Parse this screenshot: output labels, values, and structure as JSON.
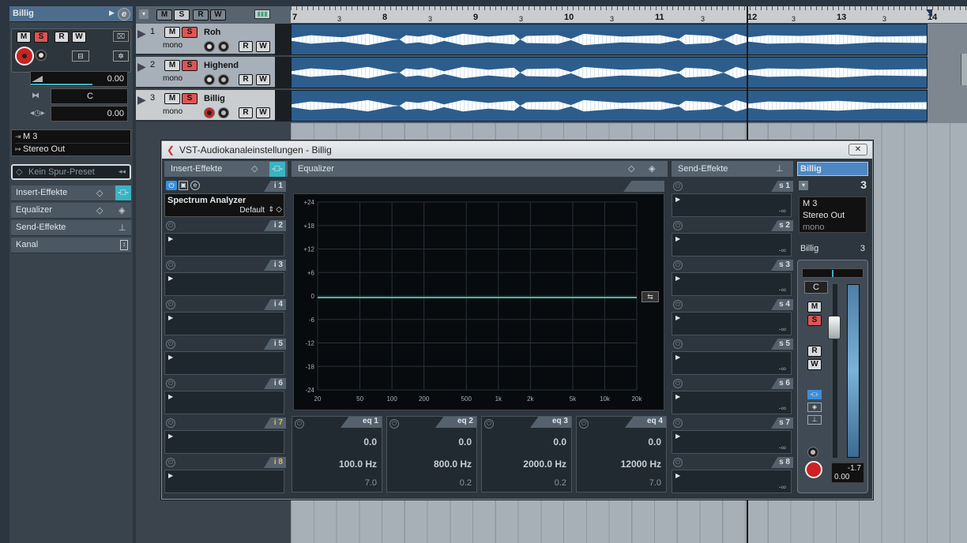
{
  "inspector": {
    "track_name": "Billig",
    "e_label": "e",
    "volume": "0.00",
    "pan": "C",
    "delay": "0.00",
    "input_routing": "M 3",
    "output_routing": "Stereo Out",
    "preset_placeholder": "Kein Spur-Preset",
    "sections": [
      "Insert-Effekte",
      "Equalizer",
      "Send-Effekte",
      "Kanal"
    ],
    "btn_m": "M",
    "btn_s": "S",
    "btn_r": "R",
    "btn_w": "W"
  },
  "tracklist": {
    "header_buttons": [
      "M",
      "S",
      "R",
      "W"
    ],
    "tracks": [
      {
        "num": "1",
        "name": "Roh",
        "mode": "mono"
      },
      {
        "num": "2",
        "name": "Highend",
        "mode": "mono"
      },
      {
        "num": "3",
        "name": "Billig",
        "mode": "mono"
      }
    ]
  },
  "ruler": {
    "bars": [
      "7",
      "8",
      "9",
      "10",
      "11",
      "12",
      "13",
      "14"
    ],
    "beats": [
      "3",
      "3",
      "3",
      "3",
      "3",
      "3",
      "3"
    ]
  },
  "dialog": {
    "title": "VST-Audiokanaleinstellungen - Billig",
    "close_label": "✕",
    "insert_panel_title": "Insert-Effekte",
    "eq_panel_title": "Equalizer",
    "send_panel_title": "Send-Effekte",
    "inserts": [
      {
        "slot": "i 1",
        "plugin": "Spectrum Analyzer",
        "preset": "Default"
      },
      {
        "slot": "i 2"
      },
      {
        "slot": "i 3"
      },
      {
        "slot": "i 4"
      },
      {
        "slot": "i 5"
      },
      {
        "slot": "i 6"
      },
      {
        "slot": "i 7"
      },
      {
        "slot": "i 8"
      }
    ],
    "sends": [
      {
        "slot": "s 1",
        "level": "-∞"
      },
      {
        "slot": "s 2",
        "level": "-∞"
      },
      {
        "slot": "s 3",
        "level": "-∞"
      },
      {
        "slot": "s 4",
        "level": "-∞"
      },
      {
        "slot": "s 5",
        "level": "-∞"
      },
      {
        "slot": "s 6",
        "level": "-∞"
      },
      {
        "slot": "s 7",
        "level": "-∞"
      },
      {
        "slot": "s 8",
        "level": "-∞"
      }
    ],
    "eq_graph": {
      "y_labels": [
        "+24",
        "+18",
        "+12",
        "+6",
        "0",
        "-6",
        "-12",
        "-18",
        "-24"
      ],
      "x_labels": [
        "20",
        "50",
        "100",
        "200",
        "500",
        "1k",
        "2k",
        "5k",
        "10k",
        "20k"
      ]
    },
    "eq_bands": [
      {
        "label": "eq 1",
        "gain": "0.0",
        "freq": "100.0 Hz",
        "q": "7.0"
      },
      {
        "label": "eq 2",
        "gain": "0.0",
        "freq": "800.0 Hz",
        "q": "0.2"
      },
      {
        "label": "eq 3",
        "gain": "0.0",
        "freq": "2000.0 Hz",
        "q": "0.2"
      },
      {
        "label": "eq 4",
        "gain": "0.0",
        "freq": "12000 Hz",
        "q": "7.0"
      }
    ],
    "channel_strip": {
      "name": "Billig",
      "number": "3",
      "input": "M 3",
      "output": "Stereo Out",
      "mode": "mono",
      "name2": "Billig",
      "number2": "3",
      "pan": "C",
      "peak": "-1.7",
      "fader_value": "0.00"
    }
  }
}
